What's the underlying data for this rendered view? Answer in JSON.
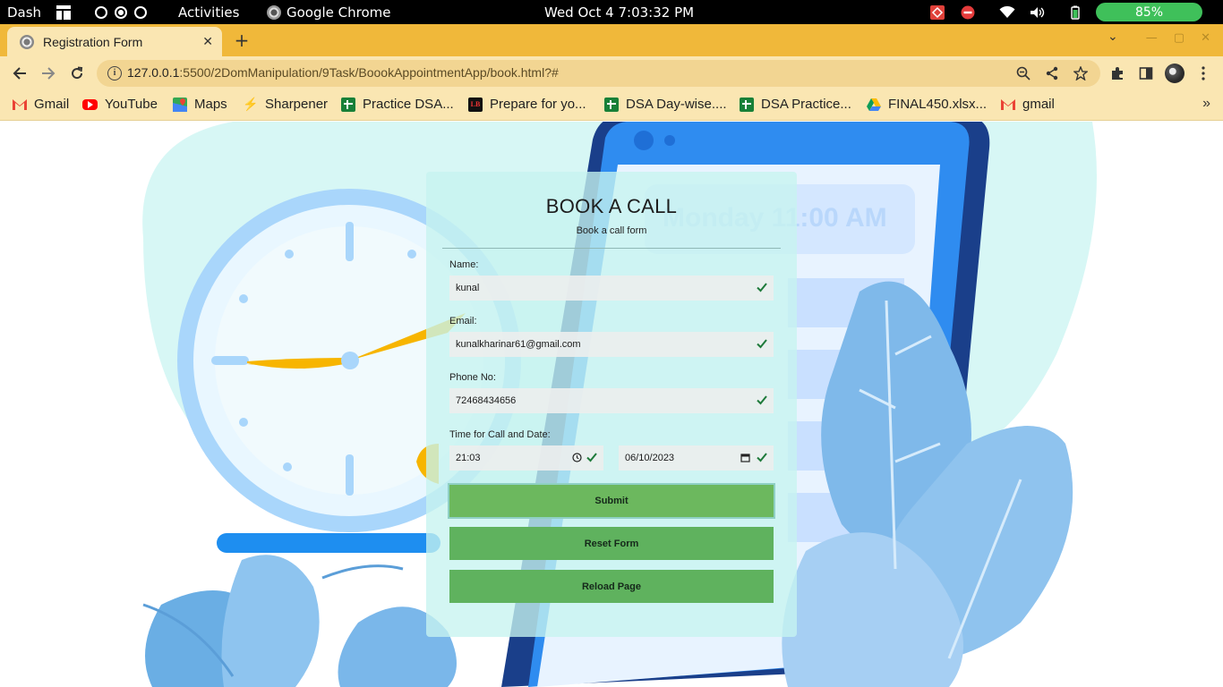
{
  "os_bar": {
    "dash": "Dash",
    "activities": "Activities",
    "app_name": "Google Chrome",
    "clock": "Wed Oct 4  7:03:32 PM",
    "battery": "85%"
  },
  "browser": {
    "tab_title": "Registration Form",
    "url_host": "127.0.0.1",
    "url_path": ":5500/2DomManipulation/9Task/BoookAppointmentApp/book.html?#"
  },
  "bookmarks": [
    {
      "label": "Gmail",
      "icon": "gmail-icon",
      "color": "#ea4335"
    },
    {
      "label": "YouTube",
      "icon": "youtube-icon",
      "color": "#ff0000"
    },
    {
      "label": "Maps",
      "icon": "maps-icon",
      "color": "#34a853"
    },
    {
      "label": "Sharpener",
      "icon": "sharpener-icon",
      "color": "#f57c00"
    },
    {
      "label": "Practice DSA...",
      "icon": "sheets-icon",
      "color": "#188038"
    },
    {
      "label": "Prepare for yo...",
      "icon": "lb-icon",
      "color": "#111111"
    },
    {
      "label": "DSA Day-wise....",
      "icon": "sheets-icon",
      "color": "#188038"
    },
    {
      "label": "DSA Practice...",
      "icon": "sheets-icon",
      "color": "#188038"
    },
    {
      "label": "FINAL450.xlsx...",
      "icon": "drive-icon",
      "color": "#fbbc04"
    },
    {
      "label": "gmail",
      "icon": "gmail-icon",
      "color": "#ea4335"
    }
  ],
  "form": {
    "title": "BOOK A CALL",
    "subtitle": "Book a call form",
    "name_label": "Name:",
    "name_value": "kunal",
    "email_label": "Email:",
    "email_value": "kunalkharinar61@gmail.com",
    "phone_label": "Phone No:",
    "phone_value": "72468434656",
    "datetime_label": "Time for Call and Date:",
    "time_value": "21:03",
    "date_value": "06/10/2023",
    "submit_label": "Submit",
    "reset_label": "Reset Form",
    "reload_label": "Reload Page"
  },
  "background": {
    "calendar_text": "Monday 11:00 AM"
  },
  "colors": {
    "tab_strip": "#f0b83a",
    "toolbar": "#fae6b2",
    "button_green": "#5fb25e",
    "check_green": "#1e7a3a",
    "card_bg": "#c6f4f0"
  }
}
